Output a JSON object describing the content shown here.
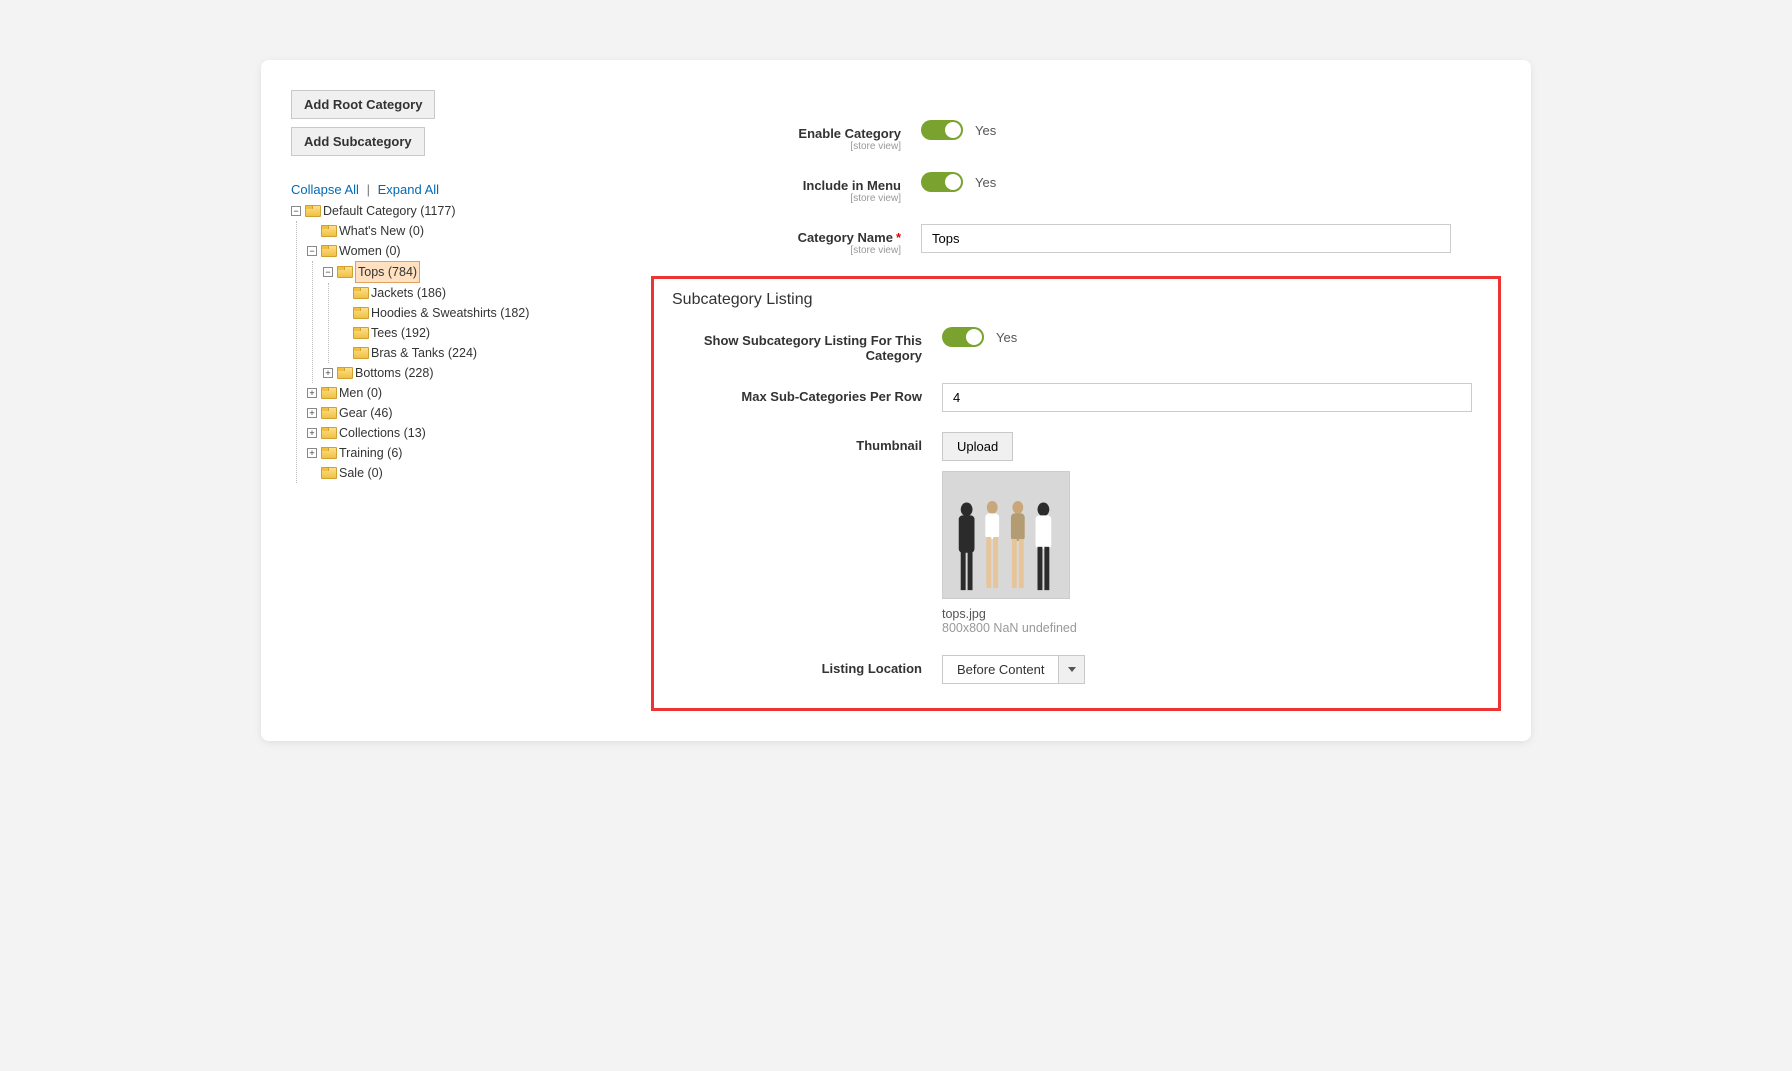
{
  "buttons": {
    "add_root": "Add Root Category",
    "add_sub": "Add Subcategory",
    "collapse": "Collapse All",
    "expand": "Expand All"
  },
  "tree": {
    "root": {
      "label": "Default Category (1177)"
    },
    "nodes": {
      "whats_new": "What's New (0)",
      "women": "Women (0)",
      "tops": "Tops (784)",
      "jackets": "Jackets (186)",
      "hoodies": "Hoodies & Sweatshirts (182)",
      "tees": "Tees (192)",
      "bras": "Bras & Tanks (224)",
      "bottoms": "Bottoms (228)",
      "men": "Men (0)",
      "gear": "Gear (46)",
      "collections": "Collections (13)",
      "training": "Training (6)",
      "sale": "Sale (0)"
    }
  },
  "form": {
    "enable_category": {
      "label": "Enable Category",
      "scope": "[store view]",
      "value_text": "Yes"
    },
    "include_in_menu": {
      "label": "Include in Menu",
      "scope": "[store view]",
      "value_text": "Yes"
    },
    "category_name": {
      "label": "Category Name",
      "scope": "[store view]",
      "value": "Tops"
    }
  },
  "subcat": {
    "section_title": "Subcategory Listing",
    "show_listing": {
      "label": "Show Subcategory Listing For This Category",
      "value_text": "Yes"
    },
    "max_per_row": {
      "label": "Max Sub-Categories Per Row",
      "value": "4"
    },
    "thumbnail": {
      "label": "Thumbnail",
      "upload_btn": "Upload",
      "filename": "tops.jpg",
      "dims": "800x800 NaN undefined"
    },
    "listing_location": {
      "label": "Listing Location",
      "value": "Before Content"
    }
  }
}
